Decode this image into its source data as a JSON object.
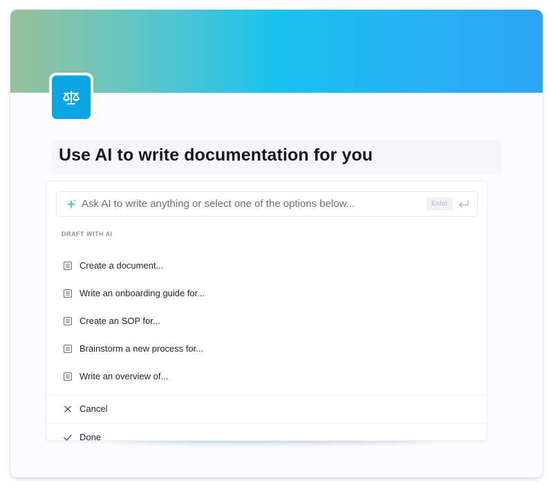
{
  "header": {
    "logo_icon": "scales-icon",
    "title": "Use AI to write documentation for you",
    "colors": {
      "banner_start": "#97c198",
      "banner_mid": "#19c2ef",
      "banner_end": "#2ea6f7",
      "logo_bg": "#0aa5e3"
    }
  },
  "ai_prompt": {
    "icon": "sparkle-icon",
    "placeholder": "Ask AI to write anything or select one of the options below...",
    "enter_label": "Enter",
    "enter_icon": "return-arrow-icon"
  },
  "menu": {
    "section_label": "DRAFT WITH AI",
    "items": [
      {
        "label": "Create a document...",
        "icon": "document-icon"
      },
      {
        "label": "Write an onboarding guide for...",
        "icon": "document-icon"
      },
      {
        "label": "Create an SOP for...",
        "icon": "document-icon"
      },
      {
        "label": "Brainstorm a new process for...",
        "icon": "document-icon"
      },
      {
        "label": "Write an overview of...",
        "icon": "document-icon"
      }
    ]
  },
  "actions": {
    "cancel_label": "Cancel",
    "cancel_icon": "close-icon",
    "done_label": "Done",
    "done_icon": "checkmark-icon"
  }
}
